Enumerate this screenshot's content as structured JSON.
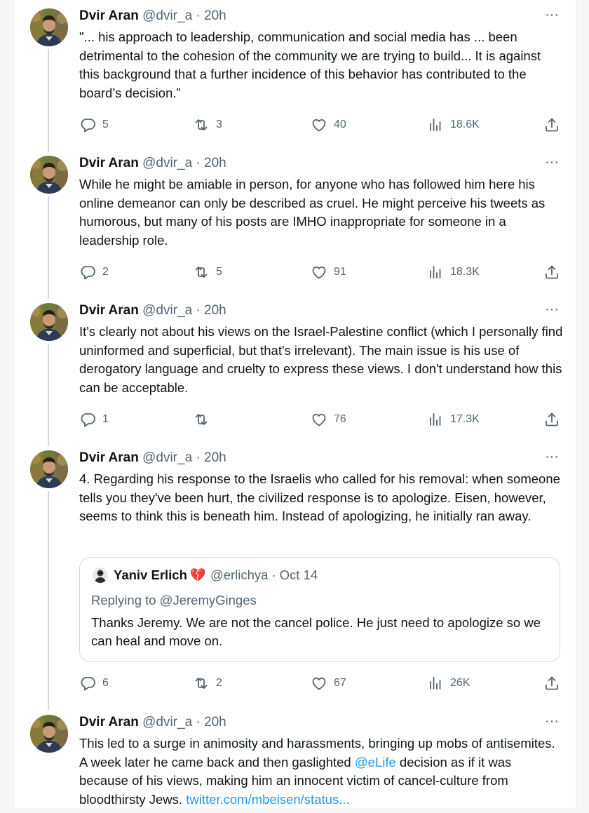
{
  "colors": {
    "accent": "#1d9bf0",
    "muted": "#536471",
    "text": "#0f1419",
    "border": "#cfd9de",
    "broken_heart": "#e0245e"
  },
  "icons": {
    "reply": "reply-icon",
    "retweet": "retweet-icon",
    "like": "heart-icon",
    "views": "views-icon",
    "share": "share-icon",
    "more": "more-icon"
  },
  "tweets": [
    {
      "name": "Dvir Aran",
      "handle": "@dvir_a",
      "sep": "·",
      "time": "20h",
      "more": "···",
      "text": "\"... his approach to leadership, communication and social media has ... been detrimental to the cohesion of the community we are trying to build... It is against this background that a further incidence of this behavior has contributed to the board’s decision.”",
      "replies": "5",
      "retweets": "3",
      "likes": "40",
      "views": "18.6K"
    },
    {
      "name": "Dvir Aran",
      "handle": "@dvir_a",
      "sep": "·",
      "time": "20h",
      "more": "···",
      "text": "While he might be amiable in person, for anyone who has followed him here his online demeanor can only be described as cruel. He might perceive his tweets as humorous, but many of his posts are IMHO inappropriate for someone in a leadership role.",
      "replies": "2",
      "retweets": "5",
      "likes": "91",
      "views": "18.3K"
    },
    {
      "name": "Dvir Aran",
      "handle": "@dvir_a",
      "sep": "·",
      "time": "20h",
      "more": "···",
      "text": "It's clearly not about his views on the Israel-Palestine conflict (which I personally find uninformed and superficial, but that's irrelevant). The main issue is his use of derogatory language and cruelty to express these views. I don't understand how this can be acceptable.",
      "replies": "1",
      "retweets": "",
      "likes": "76",
      "views": "17.3K"
    },
    {
      "name": "Dvir Aran",
      "handle": "@dvir_a",
      "sep": "·",
      "time": "20h",
      "more": "···",
      "text": "4. Regarding his response to the Israelis who called for his removal: when someone tells you they've been hurt, the civilized response is to apologize. Eisen, however, seems to think this is beneath him. Instead of apologizing, he initially ran away.",
      "quote": {
        "name": "Yaniv Erlich",
        "heart": "💔",
        "handle": "@erlichya",
        "sep": "·",
        "date": "Oct 14",
        "replying": "Replying to @JeremyGinges",
        "text": "Thanks Jeremy. We are not the cancel police. He just need to apologize so we can heal and move on."
      },
      "replies": "6",
      "retweets": "2",
      "likes": "67",
      "views": "26K"
    },
    {
      "name": "Dvir Aran",
      "handle": "@dvir_a",
      "sep": "·",
      "time": "20h",
      "more": "···",
      "text_a": "This led to a surge in animosity and harassments, bringing up mobs of antisemites. A week later he came back and then gaslighted ",
      "mention": "@eLife",
      "text_b": " decision as if it was because of his views, making him an innocent victim of cancel-culture from bloodthirsty Jews. ",
      "link": "twitter.com/mbeisen/status..."
    }
  ]
}
